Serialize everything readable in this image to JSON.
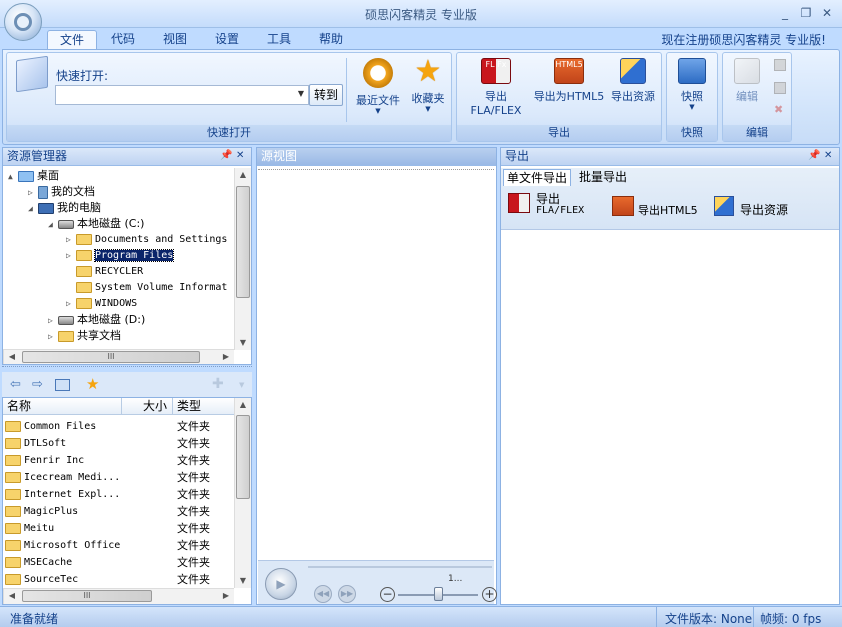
{
  "app": {
    "title": "硕思闪客精灵 专业版",
    "register_link": "现在注册硕思闪客精灵 专业版!"
  },
  "window_controls": {
    "minimize": "_",
    "restore": "❐",
    "close": "✕"
  },
  "tabs": [
    "文件",
    "代码",
    "视图",
    "设置",
    "工具",
    "帮助"
  ],
  "ribbon": {
    "quick_open": {
      "label": "快速打开:",
      "input_value": "",
      "goto_label": "转到",
      "recent_label": "最近文件",
      "favorites_label": "收藏夹",
      "group_label": "快速打开"
    },
    "export": {
      "fla_label": "导出FLA/FLEX",
      "html5_label": "导出为HTML5",
      "resources_label": "导出资源",
      "group_label": "导出",
      "fla_badge": "FL Fx",
      "html5_badge": "HTML5"
    },
    "snapshot": {
      "label": "快照",
      "group_label": "快照"
    },
    "edit": {
      "label": "编辑",
      "group_label": "编辑"
    }
  },
  "resource_manager": {
    "title": "资源管理器",
    "tree": [
      {
        "label": "桌面"
      },
      {
        "label": "我的文档"
      },
      {
        "label": "我的电脑"
      },
      {
        "label": "本地磁盘 (C:)"
      },
      {
        "label": "Documents and Settings"
      },
      {
        "label": "Program Files"
      },
      {
        "label": "RECYCLER"
      },
      {
        "label": "System Volume Informat"
      },
      {
        "label": "WINDOWS"
      },
      {
        "label": "本地磁盘 (D:)"
      },
      {
        "label": "共享文档"
      }
    ],
    "hscroll_grip": "III",
    "columns": {
      "name": "名称",
      "size": "大小",
      "type": "类型"
    },
    "files": [
      {
        "name": "Common Files",
        "type": "文件夹"
      },
      {
        "name": "DTLSoft",
        "type": "文件夹"
      },
      {
        "name": "Fenrir Inc",
        "type": "文件夹"
      },
      {
        "name": "Icecream Medi...",
        "type": "文件夹"
      },
      {
        "name": "Internet Expl...",
        "type": "文件夹"
      },
      {
        "name": "MagicPlus",
        "type": "文件夹"
      },
      {
        "name": "Meitu",
        "type": "文件夹"
      },
      {
        "name": "Microsoft Office",
        "type": "文件夹"
      },
      {
        "name": "MSECache",
        "type": "文件夹"
      },
      {
        "name": "SourceTec",
        "type": "文件夹"
      }
    ]
  },
  "source_view": {
    "title": "源视图",
    "time_readout": "1..."
  },
  "export_panel": {
    "title": "导出",
    "tabs": [
      "单文件导出",
      "批量导出"
    ],
    "buttons": {
      "fla_line1": "导出",
      "fla_line2": "FLA/FLEX",
      "html5": "导出HTML5",
      "resources": "导出资源"
    }
  },
  "status": {
    "ready": "准备就绪",
    "file_version": "文件版本: None",
    "fps": "帧频: 0 fps"
  }
}
